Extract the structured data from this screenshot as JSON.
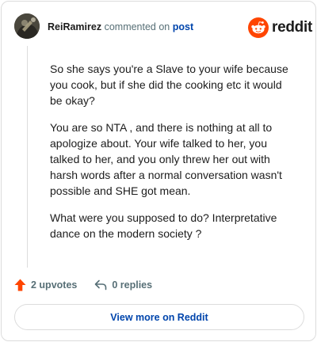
{
  "header": {
    "username": "ReiRamirez",
    "action_text": "commented on",
    "post_link": "post",
    "brand": "reddit"
  },
  "comment": {
    "paragraphs": [
      "So she says you're a Slave to your wife because you cook, but if she did the cooking etc it would be okay?",
      "You are so NTA , and there is nothing at all to apologize about. Your wife talked to her, you talked to her, and you only threw her out with harsh words after a normal conversation wasn't possible and SHE got mean.",
      "What were you supposed to do? Interpretative dance on the modern society ?"
    ]
  },
  "footer": {
    "upvotes": "2 upvotes",
    "replies": "0 replies",
    "view_more": "View more on Reddit"
  },
  "colors": {
    "brand_orange": "#ff4500",
    "link_blue": "#0045ac",
    "meta_gray": "#576f76"
  },
  "icons": [
    "avatar",
    "reddit-snoo-icon",
    "upvote-arrow-icon",
    "reply-arrow-icon"
  ]
}
